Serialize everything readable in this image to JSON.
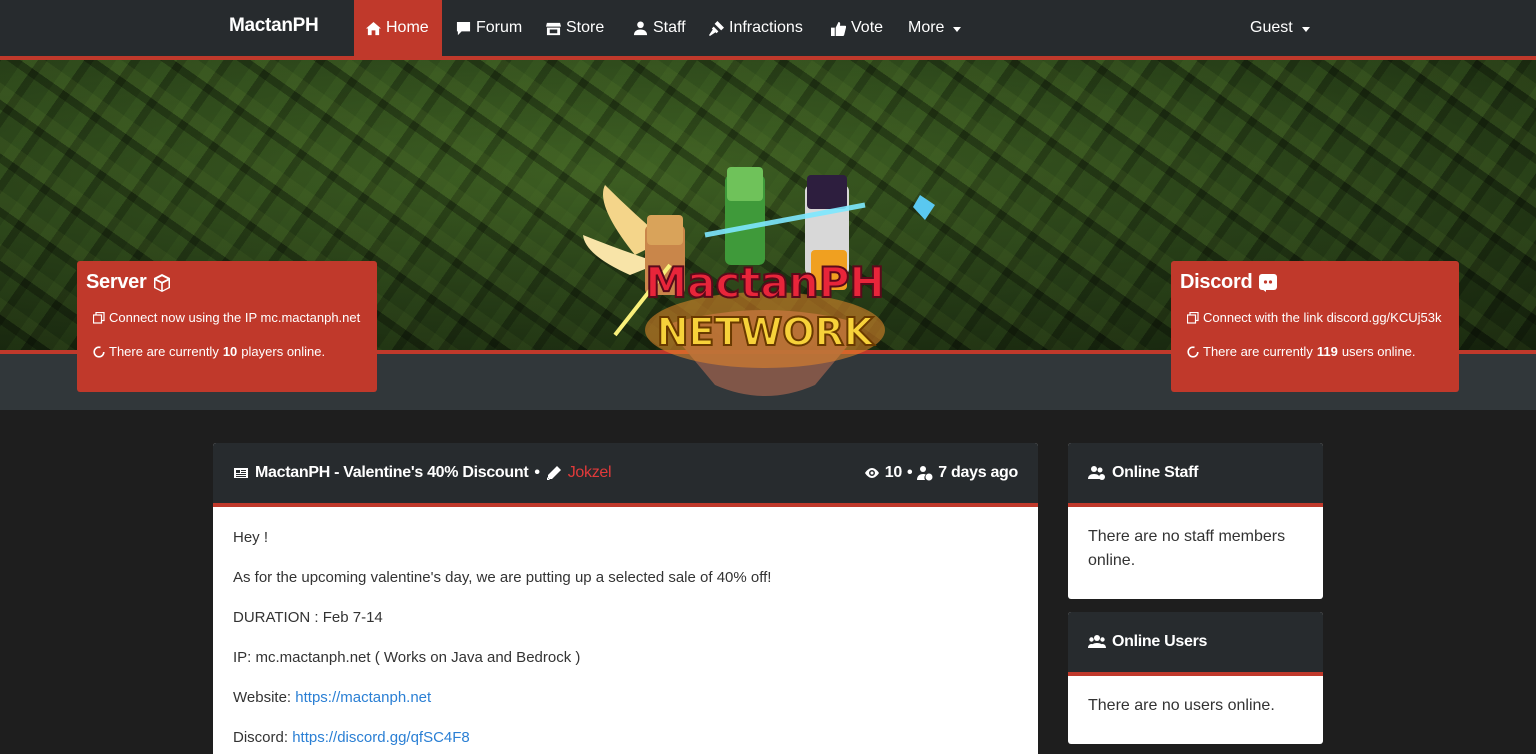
{
  "nav": {
    "brand": "MactanPH",
    "items": [
      {
        "label": "Home",
        "icon": "home-icon"
      },
      {
        "label": "Forum",
        "icon": "comment-icon"
      },
      {
        "label": "Store",
        "icon": "store-icon"
      },
      {
        "label": "Staff",
        "icon": "user-shield-icon"
      },
      {
        "label": "Infractions",
        "icon": "gavel-icon"
      },
      {
        "label": "Vote",
        "icon": "thumbs-up-icon"
      },
      {
        "label": "More",
        "icon": "chevron-down-icon"
      }
    ],
    "user_label": "Guest"
  },
  "hero": {
    "server_card": {
      "title": "Server",
      "connect_text": "Connect now using the IP mc.mactanph.net",
      "online_prefix": "There are currently",
      "online_count": "10",
      "online_suffix": "players online."
    },
    "discord_card": {
      "title": "Discord",
      "connect_text": "Connect with the link discord.gg/KCUj53k",
      "online_prefix": "There are currently",
      "online_count": "119",
      "online_suffix": "users online."
    },
    "logo_text_top": "MactanPH",
    "logo_text_bottom": "NETWORK"
  },
  "news": {
    "title": "MactanPH - Valentine's 40% Discount",
    "separator": "•",
    "author": "Jokzel",
    "views": "10",
    "time": "7 days ago",
    "paragraphs": [
      "Hey !",
      "As for the upcoming valentine's day, we are putting up a selected sale of 40% off!",
      "DURATION : Feb 7-14",
      "IP: mc.mactanph.net ( Works on Java and Bedrock )"
    ],
    "website_label": "Website:",
    "website_link": "https://mactanph.net",
    "discord_label": "Discord:",
    "discord_link": "https://discord.gg/qfSC4F8"
  },
  "sidebar": {
    "online_staff": {
      "title": "Online Staff",
      "body": "There are no staff members online."
    },
    "online_users": {
      "title": "Online Users",
      "body": "There are no users online."
    }
  },
  "colors": {
    "accent": "#c0392b",
    "dark": "#272b2e",
    "link": "#2a7fd4"
  }
}
